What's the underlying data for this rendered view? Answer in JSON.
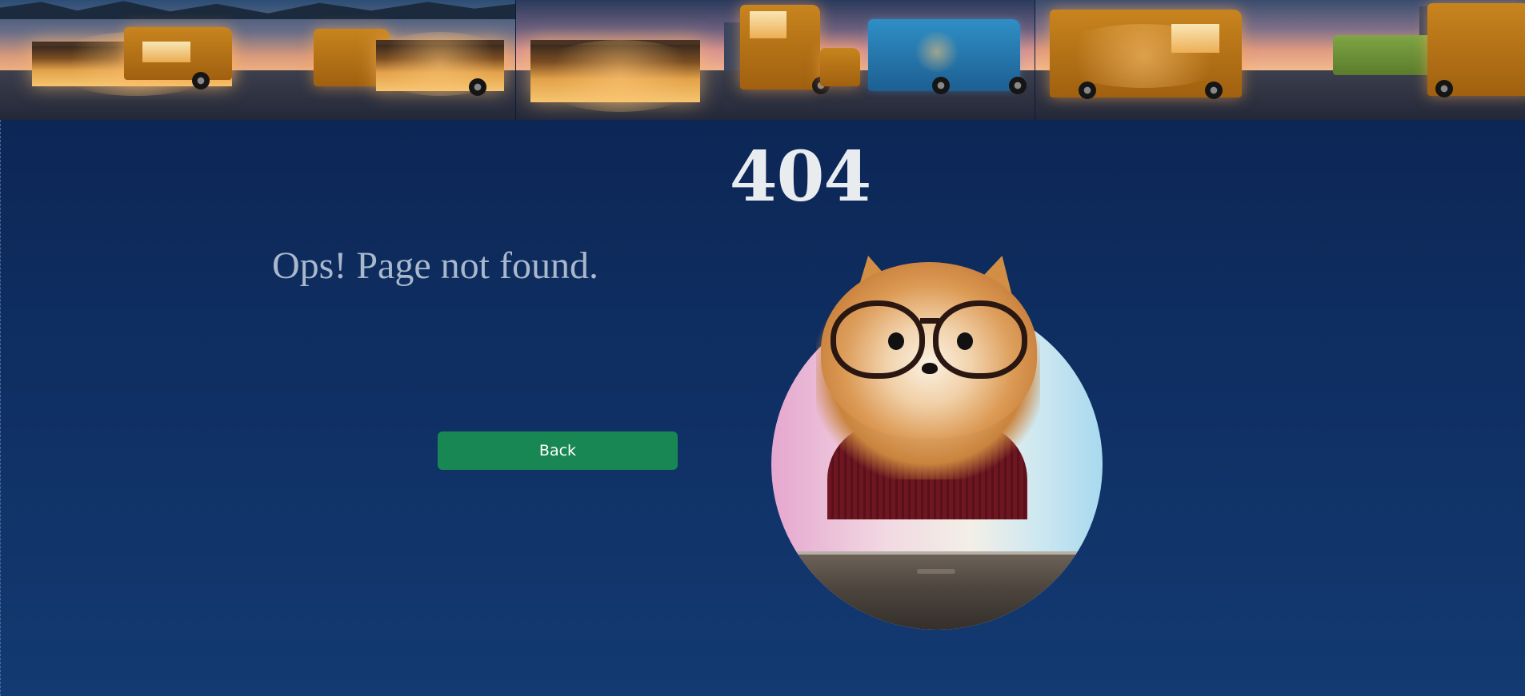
{
  "banner": {
    "images": [
      {
        "icon": "food-truck-market-image"
      },
      {
        "icon": "food-truck-street-image"
      },
      {
        "icon": "food-truck-city-image"
      }
    ]
  },
  "error": {
    "code": "404",
    "message": "Ops! Page not found."
  },
  "actions": {
    "back_label": "Back"
  },
  "illustration": {
    "icon": "dog-with-glasses-image"
  },
  "colors": {
    "background": "#0f2f63",
    "button": "#198754",
    "heading": "#e9ecef",
    "message": "#a9b8cc"
  }
}
